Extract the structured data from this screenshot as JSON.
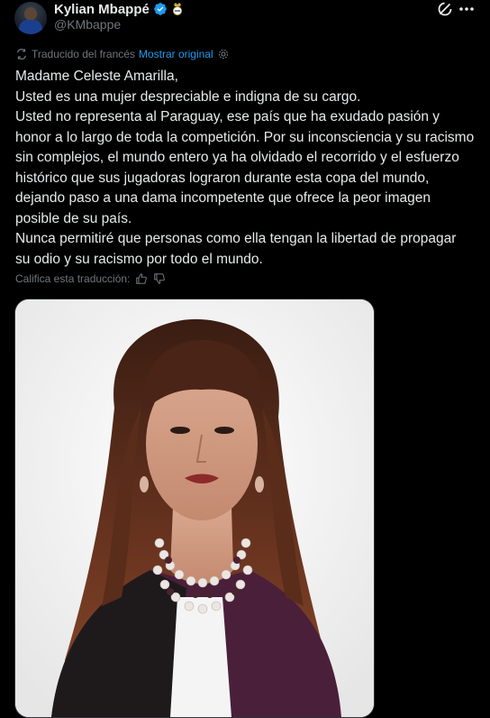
{
  "tweet": {
    "author_name": "Kylian Mbappé",
    "handle": "@KMbappe",
    "translated_from": "Traducido del francés",
    "show_original": "Mostrar original",
    "paragraphs": [
      "Madame Celeste Amarilla,",
      "Usted es una mujer despreciable e indigna de su cargo.",
      "Usted no representa al Paraguay, ese país que ha exudado pasión y honor a lo largo de toda la competición. Por su inconsciencia y su racismo sin complejos, el mundo entero ya ha olvidado el recorrido y el esfuerzo histórico que sus jugadoras lograron durante esta copa del mundo, dejando paso a una dama incompetente que ofrece la peor imagen posible de su país.",
      "Nunca permitiré que personas como ella tengan la libertad de propagar su odio y su racismo por todo el mundo."
    ],
    "rate_translation": "Califica esta traducción:"
  },
  "icons": {
    "verified": "verified-badge-icon",
    "club": "club-crest-icon",
    "grok": "grok-icon",
    "more": "more-icon",
    "translate": "translate-icon",
    "settings": "gear-icon",
    "thumbs_up": "thumbs-up-icon",
    "thumbs_down": "thumbs-down-icon"
  },
  "colors": {
    "background": "#000000",
    "text": "#e7e9ea",
    "muted": "#71767b",
    "link": "#1d9bf0"
  }
}
